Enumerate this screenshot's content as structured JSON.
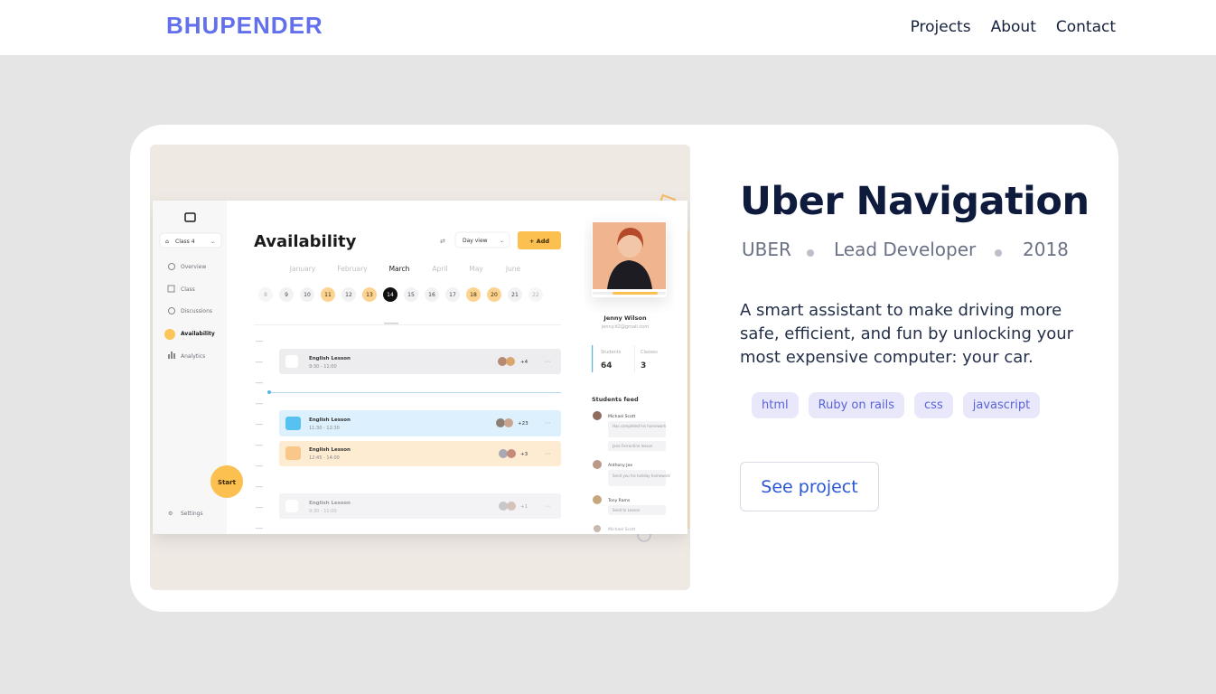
{
  "brand": "BHUPENDER",
  "nav": {
    "links": [
      "Projects",
      "About",
      "Contact"
    ]
  },
  "project": {
    "title": "Uber Navigation",
    "company": "UBER",
    "role": "Lead Developer",
    "year": "2018",
    "description": "A smart assistant to make driving more safe, efficient, and fun by unlocking your most expensive computer: your car.",
    "tags": [
      "html",
      "Ruby on rails",
      "css",
      "javascript"
    ],
    "cta": "See project"
  },
  "mockup": {
    "class_select": "Class 4",
    "menu": [
      "Overview",
      "Class",
      "Discussions",
      "Availability",
      "Analytics"
    ],
    "settings": "Settings",
    "start": "Start",
    "heading": "Availability",
    "view": "Day view",
    "add": "+ Add",
    "months": [
      "January",
      "February",
      "March",
      "April",
      "May",
      "June"
    ],
    "days": [
      "8",
      "9",
      "10",
      "11",
      "12",
      "13",
      "14",
      "15",
      "16",
      "17",
      "18",
      "20",
      "21",
      "22"
    ],
    "lessons": [
      {
        "name": "English Lesson",
        "time": "9:30 - 11:00",
        "count": "+4"
      },
      {
        "name": "English Lesson",
        "time": "11:30 - 12:30",
        "count": "+23"
      },
      {
        "name": "English Lesson",
        "time": "12:45 - 14:00",
        "count": "+3"
      },
      {
        "name": "English Lesson",
        "time": "9:30 - 11:00",
        "count": "+1"
      }
    ],
    "profile": {
      "name": "Jenny Wilson",
      "email": "jenny.d2@gmail.com",
      "students_label": "Students",
      "students": "64",
      "classes_label": "Classes",
      "classes": "3"
    },
    "feed_title": "Students feed",
    "feed": [
      {
        "name": "Michael Scott",
        "msg1": "Has completed his homework",
        "msg2": "Jane Ferrantine lesson"
      },
      {
        "name": "Anthony Joe",
        "msg1": "Send you his holiday homework"
      },
      {
        "name": "Tony Rams",
        "msg1": "Send to Lesson"
      },
      {
        "name": "Michael Scott"
      }
    ]
  }
}
